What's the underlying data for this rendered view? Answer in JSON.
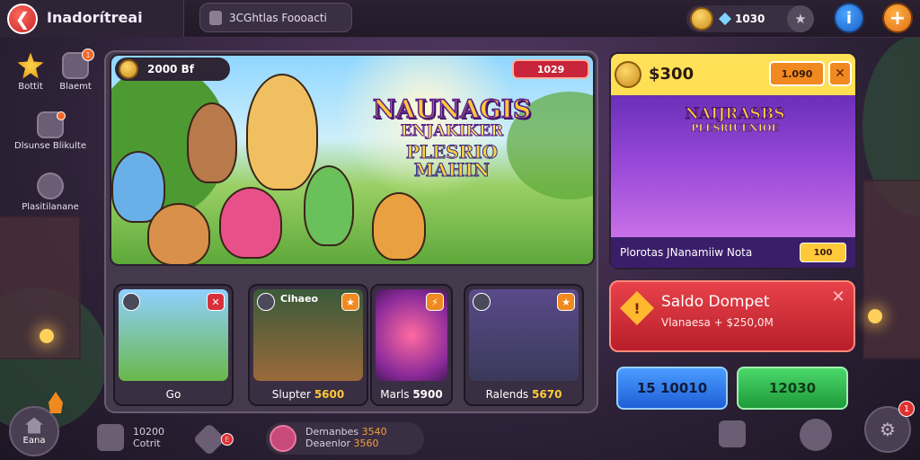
{
  "app": {
    "title": "Inadorítreai"
  },
  "search": {
    "text": "3CGhtlas Foooacti"
  },
  "currency": {
    "value": "1030"
  },
  "topbar": {
    "info_icon": "info-icon",
    "add_icon": "plus-icon"
  },
  "sidebar": {
    "items": [
      {
        "label": "Bottit",
        "icon": "star-icon"
      },
      {
        "label": "Blaemt",
        "icon": "shop-icon",
        "badge": "1"
      },
      {
        "label": "Dlsunse Blikulte",
        "icon": "house-icon",
        "badge": ""
      },
      {
        "label": "Plasitilanane",
        "icon": "shield-icon"
      }
    ]
  },
  "hero": {
    "coins": "2000 Bf",
    "badge": "1029",
    "logo_line1": "NAUNAGIS",
    "logo_line2": "ENJAKIKER",
    "logo_line3": "PLESRIO MAHIN"
  },
  "cards": [
    {
      "title": "",
      "label": "Go",
      "num": ""
    },
    {
      "title": "Cihaeo",
      "label": "Slupter",
      "num": "5600"
    },
    {
      "title": "",
      "label": "Marls",
      "num": "5900"
    },
    {
      "title": "",
      "label": "Ralends",
      "num": "5670"
    }
  ],
  "promo": {
    "amount": "$300",
    "price": "1.090",
    "close": "✕",
    "logo_line1": "NAIJRASBS",
    "logo_line2": "PLESRIUENIOE",
    "name": "Plorotas JNanamiiw Nota",
    "buy": "100"
  },
  "wallet": {
    "title": "Saldo Dompet",
    "subtitle": "Vlanaesa + $250,0M",
    "close": "✕"
  },
  "buttons": {
    "blue": "15 10010",
    "green": "12030"
  },
  "bottom": {
    "home": "Eana",
    "item1_value": "10200",
    "item1_label": "Cotrit",
    "item2_line1": "Demanbes",
    "item2_num1": "3540",
    "item2_line2": "Deaenlor",
    "item2_num2": "3560",
    "settings_badge": "1"
  },
  "colors": {
    "accent_orange": "#f08a20",
    "accent_red": "#c8242a",
    "wallet_red": "#d8303a",
    "blue_btn": "#2f7ae8",
    "green_btn": "#2fb84a",
    "gold": "#ffc93a"
  }
}
